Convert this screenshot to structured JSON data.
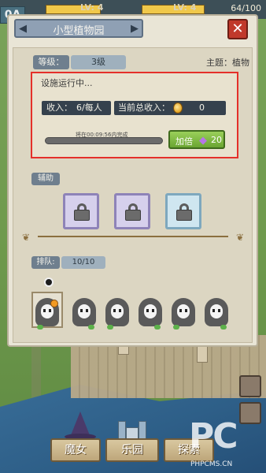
{
  "topbar": {
    "level_left": "LV: 4",
    "level_right": "LV: 4",
    "coins": "64/100",
    "left_badge": "0A"
  },
  "panel": {
    "title": "小型植物园",
    "close_label": "✕",
    "level_label": "等级：",
    "level_value": "3级",
    "theme": "主题：植物"
  },
  "run": {
    "status": "设施运行中...",
    "income_label": "收入：",
    "income_value": "6/每人",
    "total_label": "当前总收入：",
    "total_value": "0",
    "progress_text": "将在00:09:56内完成",
    "progress": 0.0,
    "boost_label": "加倍",
    "boost_cost": "20"
  },
  "assist": {
    "label": "辅助",
    "slots": [
      "locked",
      "locked",
      "locked"
    ]
  },
  "team": {
    "label": "排队:",
    "count": "10/10",
    "members": 6
  },
  "nav": {
    "witch": "魔女",
    "castle": "乐园",
    "third": "探索"
  },
  "watermark": {
    "logo": "PC",
    "url": "PHPCMS.CN"
  },
  "colors": {
    "highlight": "#e5302a",
    "boost": "#6aa532",
    "close": "#c0392b"
  }
}
